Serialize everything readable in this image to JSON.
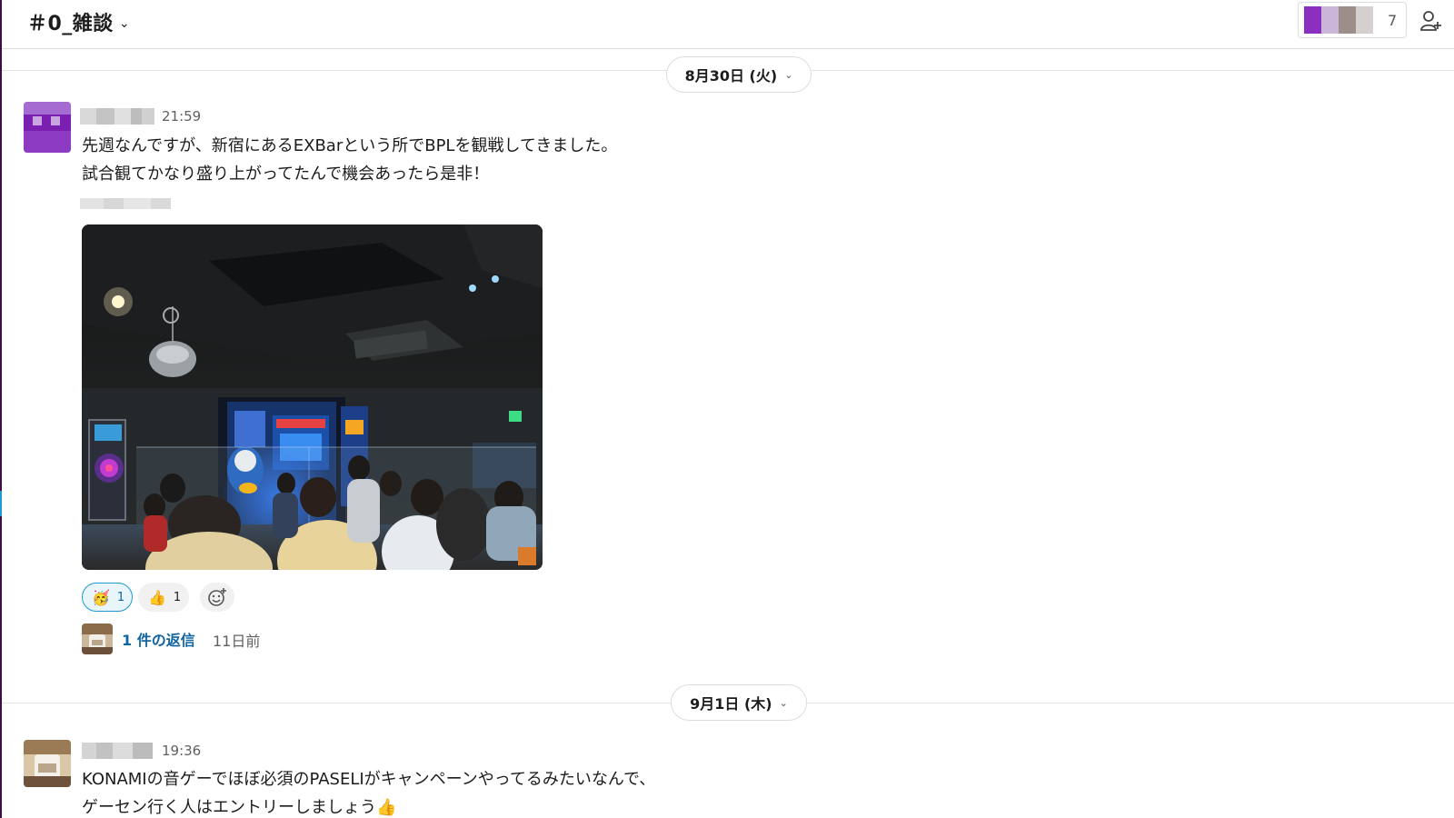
{
  "channel": {
    "title": "＃0_雑談"
  },
  "members": {
    "count": "7"
  },
  "colors": {
    "sidebar": "#3f0e40",
    "link": "#1264a3",
    "reaction_active_border": "#1d9bd1",
    "avatar_purple": "#7a1fb0"
  },
  "dates": [
    {
      "label": "8月30日 (火)"
    },
    {
      "label": "9月1日 (木)"
    }
  ],
  "messages": [
    {
      "time": "21:59",
      "lines": [
        "先週なんですが、新宿にあるEXBarという所でBPLを観戦してきました。",
        "試合観てかなり盛り上がってたんで機会あったら是非！"
      ],
      "reactions": [
        {
          "emoji": "🥳",
          "count": "1"
        },
        {
          "emoji": "👍",
          "count": "1"
        }
      ],
      "thread": {
        "replies": "1 件の返信",
        "age": "11日前"
      }
    },
    {
      "time": "19:36",
      "lines": [
        "KONAMIの音ゲーでほぼ必須のPASELIがキャンペーンやってるみたいなんで、",
        "ゲーセン行く人はエントリーしましょう👍"
      ]
    }
  ]
}
